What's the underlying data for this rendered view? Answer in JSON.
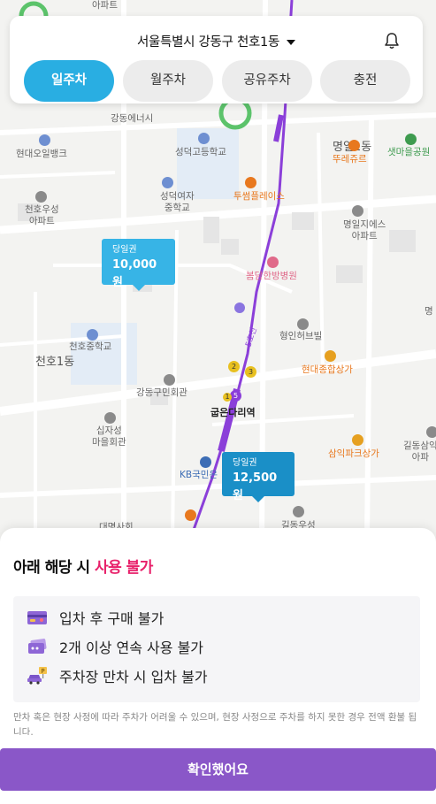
{
  "header": {
    "location": "서울특별시 강동구 천호1동",
    "tabs": [
      {
        "label": "일주차",
        "active": true
      },
      {
        "label": "월주차",
        "active": false
      },
      {
        "label": "공유주차",
        "active": false
      },
      {
        "label": "충전",
        "active": false
      }
    ]
  },
  "map": {
    "labels": {
      "apt_top": "아파트",
      "gangdong_center": "강동에너시",
      "myeong_dong": "명일1동",
      "hyundai_oil": "현대오일뱅크",
      "seongdeok_high": "성덕고등학교",
      "ttureju": "뚜레쥬르",
      "saetmaeul_park": "샛마을공원",
      "seongdeok_girls_1": "성덕여자",
      "seongdeok_girls_2": "중학교",
      "tuseom_place": "투썸플레이스",
      "cheonho_woosung_1": "천호우성",
      "cheonho_woosung_2": "아파트",
      "myeongil_jies_1": "명일지에스",
      "myeongil_jies_2": "아파트",
      "bomdam_clinic": "봄담한방병원",
      "hyungin_herb": "형인허브빌",
      "cheonho_middle": "천호중학교",
      "cheonho1dong": "천호1동",
      "line5": "5호선",
      "hyundai_mall": "현대종합상가",
      "gangdong_hall": "강동구민회관",
      "gubeundari": "굽은다리역",
      "sipjaseong_1": "십자성",
      "sipjaseong_2": "마을회관",
      "samik_park": "삼익파크상가",
      "gildong_samik_1": "길동삼익",
      "gildong_samik_2": "아파",
      "kb_bank": "KB국민은",
      "gildong_post": "길동우성",
      "myeong_edge": "명",
      "bottom_label": "대명사회"
    },
    "markers": [
      {
        "type": "당일권",
        "price": "10,000원",
        "color": "#37b4e6"
      },
      {
        "type": "당일권",
        "price": "12,500원",
        "color": "#1a8fc7"
      }
    ]
  },
  "sheet": {
    "title_prefix": "아래 해당 시 ",
    "title_warn": "사용 불가",
    "rules": [
      {
        "icon": "credit-card-icon",
        "text": "입차 후 구매 불가"
      },
      {
        "icon": "tickets-icon",
        "text": "2개 이상 연속 사용 불가"
      },
      {
        "icon": "car-parking-icon",
        "text": "주차장 만차 시 입차 불가"
      }
    ],
    "notice": "만차 혹은 현장 사정에 따라 주차가 어려울 수 있으며, 현장 사정으로 주차를 하지 못한 경우 전액 환불 됩니다.",
    "confirm_label": "확인했어요"
  },
  "colors": {
    "accent_blue": "#29aee2",
    "warn_pink": "#e8206a",
    "confirm_purple": "#8a57c8",
    "subway_purple": "#8b3fd9"
  }
}
